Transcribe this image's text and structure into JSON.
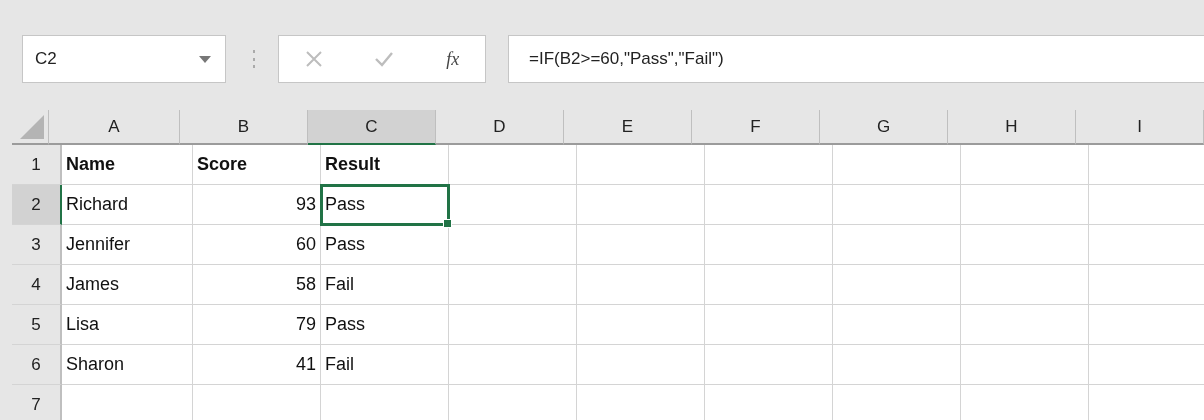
{
  "name_box": {
    "value": "C2"
  },
  "formula_bar": {
    "function_label": "fx",
    "value": "=IF(B2>=60,\"Pass\",\"Fail\")"
  },
  "columns": [
    {
      "label": "A",
      "selected": false
    },
    {
      "label": "B",
      "selected": false
    },
    {
      "label": "C",
      "selected": true
    },
    {
      "label": "D",
      "selected": false
    },
    {
      "label": "E",
      "selected": false
    },
    {
      "label": "F",
      "selected": false
    },
    {
      "label": "G",
      "selected": false
    },
    {
      "label": "H",
      "selected": false
    },
    {
      "label": "I",
      "selected": false
    }
  ],
  "rows": [
    {
      "label": "1",
      "selected": false,
      "cells": [
        {
          "kind": "header",
          "text": "Name",
          "selected": false
        },
        {
          "kind": "header",
          "text": "Score",
          "selected": false
        },
        {
          "kind": "header",
          "text": "Result",
          "selected": false
        }
      ]
    },
    {
      "label": "2",
      "selected": true,
      "cells": [
        {
          "kind": "text",
          "text": "Richard",
          "selected": false
        },
        {
          "kind": "number",
          "text": "93",
          "selected": false
        },
        {
          "kind": "text",
          "text": "Pass",
          "selected": true
        }
      ]
    },
    {
      "label": "3",
      "selected": false,
      "cells": [
        {
          "kind": "text",
          "text": "Jennifer",
          "selected": false
        },
        {
          "kind": "number",
          "text": "60",
          "selected": false
        },
        {
          "kind": "text",
          "text": "Pass",
          "selected": false
        }
      ]
    },
    {
      "label": "4",
      "selected": false,
      "cells": [
        {
          "kind": "text",
          "text": "James",
          "selected": false
        },
        {
          "kind": "number",
          "text": "58",
          "selected": false
        },
        {
          "kind": "text",
          "text": "Fail",
          "selected": false
        }
      ]
    },
    {
      "label": "5",
      "selected": false,
      "cells": [
        {
          "kind": "text",
          "text": "Lisa",
          "selected": false
        },
        {
          "kind": "number",
          "text": "79",
          "selected": false
        },
        {
          "kind": "text",
          "text": "Pass",
          "selected": false
        }
      ]
    },
    {
      "label": "6",
      "selected": false,
      "cells": [
        {
          "kind": "text",
          "text": "Sharon",
          "selected": false
        },
        {
          "kind": "number",
          "text": "41",
          "selected": false
        },
        {
          "kind": "text",
          "text": "Fail",
          "selected": false
        }
      ]
    },
    {
      "label": "7",
      "selected": false,
      "cells": []
    }
  ]
}
